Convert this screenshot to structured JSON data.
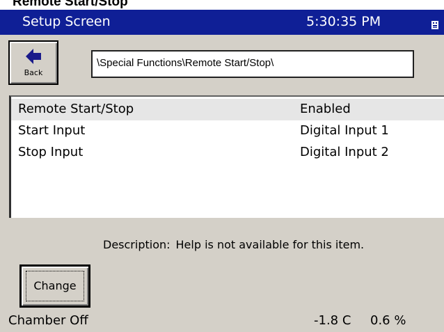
{
  "document_heading": "Remote Start/Stop",
  "titlebar": {
    "title": "Setup Screen",
    "time": "5:30:35 PM",
    "tray_icon": "keyboard-icon"
  },
  "back_button": {
    "label": "Back",
    "icon": "left-arrow-icon"
  },
  "path": "\\Special Functions\\Remote Start/Stop\\",
  "settings": [
    {
      "name": "Remote Start/Stop",
      "value": "Enabled",
      "selected": true
    },
    {
      "name": "Start Input",
      "value": "Digital Input 1",
      "selected": false
    },
    {
      "name": "Stop Input",
      "value": "Digital Input 2",
      "selected": false
    }
  ],
  "description": {
    "label": "Description:",
    "text": "Help is not available for this item."
  },
  "change_button": {
    "label": "Change"
  },
  "status": {
    "chamber": "Chamber Off",
    "temperature": "-1.8 C",
    "percent": "0.6 %"
  },
  "colors": {
    "titlebar": "#0f1f96",
    "panel": "#d4d0c8",
    "selected_row": "#e6e6e6"
  }
}
